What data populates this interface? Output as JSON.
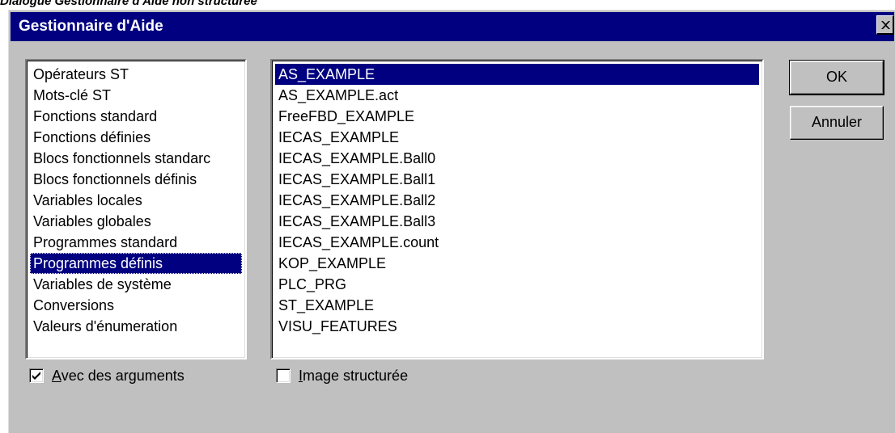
{
  "caption": "Dialogue Gestionnaire d'Aide non structurée",
  "dialog": {
    "title": "Gestionnaire d'Aide"
  },
  "categories": {
    "items": [
      "Opérateurs ST",
      "Mots-clé ST",
      "Fonctions standard",
      "Fonctions définies",
      "Blocs fonctionnels standarc",
      "Blocs fonctionnels définis",
      "Variables locales",
      "Variables globales",
      "Programmes standard",
      "Programmes définis",
      "Variables de système",
      "Conversions",
      "Valeurs d'énumeration"
    ],
    "selected_index": 9
  },
  "entries": {
    "items": [
      "AS_EXAMPLE",
      "AS_EXAMPLE.act",
      "FreeFBD_EXAMPLE",
      "IECAS_EXAMPLE",
      "IECAS_EXAMPLE.Ball0",
      "IECAS_EXAMPLE.Ball1",
      "IECAS_EXAMPLE.Ball2",
      "IECAS_EXAMPLE.Ball3",
      "IECAS_EXAMPLE.count",
      "KOP_EXAMPLE",
      "PLC_PRG",
      "ST_EXAMPLE",
      "VISU_FEATURES"
    ],
    "selected_index": 0
  },
  "buttons": {
    "ok": "OK",
    "cancel": "Annuler"
  },
  "options": {
    "with_arguments": {
      "label_underlined": "A",
      "label_rest": "vec des arguments",
      "checked": true
    },
    "structured_image": {
      "label_underlined": "I",
      "label_rest": "mage structurée",
      "checked": false
    }
  },
  "colors": {
    "face": "#c0c0c0",
    "titlebar": "#000080",
    "selection": "#000080"
  },
  "icons": {
    "close": "close-icon",
    "checkmark": "checkmark-icon"
  }
}
